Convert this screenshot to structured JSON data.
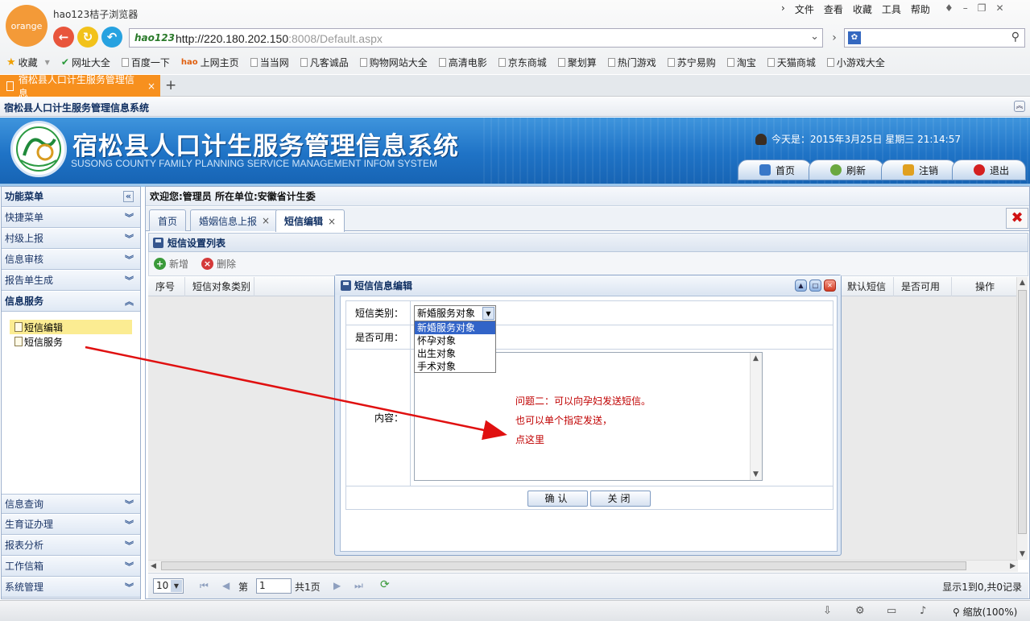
{
  "browser": {
    "logo": "orange",
    "name": "hao123桔子浏览器",
    "menu": [
      "文件",
      "查看",
      "收藏",
      "工具",
      "帮助"
    ],
    "address": {
      "brand": "hao123",
      "host": "http://220.180.202.150",
      "rest": ":8008/Default.aspx"
    },
    "bookmarks": [
      "收藏",
      "网址大全",
      "百度一下",
      "上网主页",
      "当当网",
      "凡客诚品",
      "购物网站大全",
      "高清电影",
      "京东商城",
      "聚划算",
      "热门游戏",
      "苏宁易购",
      "淘宝",
      "天猫商城",
      "小游戏大全"
    ],
    "tab_title": "宿松县人口计生服务管理信息",
    "zoom": "缩放(100%)"
  },
  "app": {
    "window_title": "宿松县人口计生服务管理信息系统",
    "title": "宿松县人口计生服务管理信息系统",
    "subtitle": "SUSONG COUNTY FAMILY PLANNING SERVICE MANAGEMENT INFOM SYSTEM",
    "today": "今天是：2015年3月25日 星期三 21:14:57",
    "top_nav": [
      "首页",
      "刷新",
      "注销",
      "退出"
    ]
  },
  "sidebar": {
    "header": "功能菜单",
    "groups_top": [
      "快捷菜单",
      "村级上报",
      "信息审核",
      "报告单生成",
      "信息服务"
    ],
    "items": [
      "短信编辑",
      "短信服务"
    ],
    "groups_bottom": [
      "信息查询",
      "生育证办理",
      "报表分析",
      "工作信箱",
      "系统管理"
    ]
  },
  "main": {
    "welcome": "欢迎您:管理员 所在单位:安徽省计生委",
    "tabs": [
      "首页",
      "婚姻信息上报",
      "短信编辑"
    ],
    "list_title": "短信设置列表",
    "toolbar": {
      "add": "新增",
      "delete": "删除"
    },
    "columns": [
      "序号",
      "短信对象类别",
      "默认短信",
      "是否可用",
      "操作"
    ],
    "pager": {
      "page_size": "10",
      "page_label": "第",
      "page": "1",
      "total": "共1页",
      "status": "显示1到0,共0记录"
    }
  },
  "modal": {
    "title": "短信信息编辑",
    "type_label": "短信类别：",
    "type_selected": "新婚服务对象",
    "type_options": [
      "新婚服务对象",
      "怀孕对象",
      "出生对象",
      "手术对象"
    ],
    "enabled_label": "是否可用：",
    "content_label": "内容：",
    "note_lines": [
      "问题二：可以向孕妇发送短信。",
      "也可以单个指定发送，",
      "点这里"
    ],
    "ok": "确认",
    "close": "关闭"
  },
  "colors": {
    "accent": "#f7901e",
    "banner": "#1f73c6",
    "annotation": "#e01010"
  }
}
